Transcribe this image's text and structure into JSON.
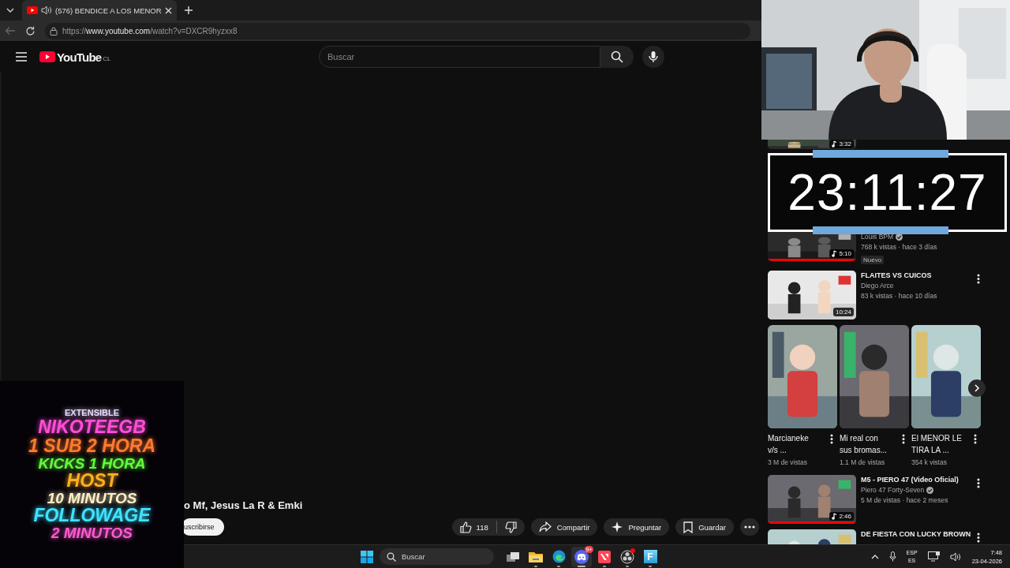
{
  "browser": {
    "tab": {
      "title": "(576) BENDICE A LOS MENOR",
      "audio": true,
      "selected": true
    },
    "back_disabled": true,
    "url": {
      "scheme": "https://",
      "host": "www.youtube.com",
      "path": "/watch?v=DXCR9hyzxx8"
    }
  },
  "youtube": {
    "logo": "YouTube",
    "country": "CL",
    "search_placeholder": "Buscar"
  },
  "video": {
    "title": "o Mf, Jesus La R & Emki",
    "subscribe": "uscribirse",
    "likes": "118",
    "actions": [
      {
        "kind": "share",
        "label": "Compartir"
      },
      {
        "kind": "ask",
        "label": "Preguntar"
      },
      {
        "kind": "save",
        "label": "Guardar"
      },
      {
        "kind": "more"
      }
    ]
  },
  "recommendations": [
    {
      "kind": "partial",
      "duration": "3:32",
      "music": true
    },
    {
      "kind": "video",
      "channel": "Louis BPM",
      "verified": true,
      "meta": "768 k vistas · hace 3 días",
      "badge": "Nuevo",
      "duration": "5:10",
      "music": true,
      "watched": true
    },
    {
      "kind": "video",
      "title": "FLAITES VS CUICOS",
      "channel": "Diego Arce",
      "verified": false,
      "meta": "83 k vistas · hace 10 días",
      "duration": "10:24",
      "music": false,
      "watched": false
    },
    {
      "kind": "shorts",
      "items": [
        {
          "title": "Marcianeke v/s ...",
          "views": "3 M de vistas"
        },
        {
          "title": "Mi real con sus bromas...",
          "views": "1.1 M de vistas"
        },
        {
          "title": "El MENOR LE TIRA LA ...",
          "views": "354 k vistas"
        }
      ]
    },
    {
      "kind": "video",
      "title": "M5 - PIERO 47 (Video Oficial)",
      "channel": "Piero 47 Forty-Seven",
      "verified": true,
      "meta": "5 M de vistas · hace 2 meses",
      "duration": "2:46",
      "music": true,
      "watched": true
    },
    {
      "kind": "video",
      "title": "DE FIESTA CON LUCKY BROWN"
    }
  ],
  "timer": {
    "time": "23:11:27"
  },
  "stream_overlay": {
    "lines": [
      {
        "text": "EXTENSIBLE",
        "color": "#e8dcff"
      },
      {
        "text": "NIKOTEEGB",
        "color": "#ff4fd8"
      },
      {
        "text": "1 SUB 2 HORA",
        "color": "#ff7a2e"
      },
      {
        "text": "KICKS 1 HORA",
        "color": "#62ff3a"
      },
      {
        "text": "HOST",
        "color": "#ffb020"
      },
      {
        "text": "10 MINUTOS",
        "color": "#fff1c4"
      },
      {
        "text": "FOLLOWAGE",
        "color": "#3fe3ff"
      },
      {
        "text": "2 MINUTOS",
        "color": "#ff5ad0"
      }
    ]
  },
  "taskbar": {
    "search_placeholder": "Buscar",
    "apps": [
      {
        "kind": "task-view",
        "running": false,
        "selected": false
      },
      {
        "kind": "folder",
        "running": true,
        "selected": false
      },
      {
        "kind": "browser",
        "running": true,
        "selected": false
      },
      {
        "kind": "chat",
        "running": true,
        "selected": true,
        "badge": "9+"
      },
      {
        "kind": "game",
        "running": true,
        "selected": false
      },
      {
        "kind": "recorder",
        "running": true,
        "selected": false,
        "alert": true
      },
      {
        "kind": "letter",
        "letter": "F",
        "running": true,
        "selected": false
      }
    ],
    "tray": {
      "language": "ESP",
      "layout": "ES",
      "time": "7:48",
      "date": "23-04-2026"
    }
  }
}
